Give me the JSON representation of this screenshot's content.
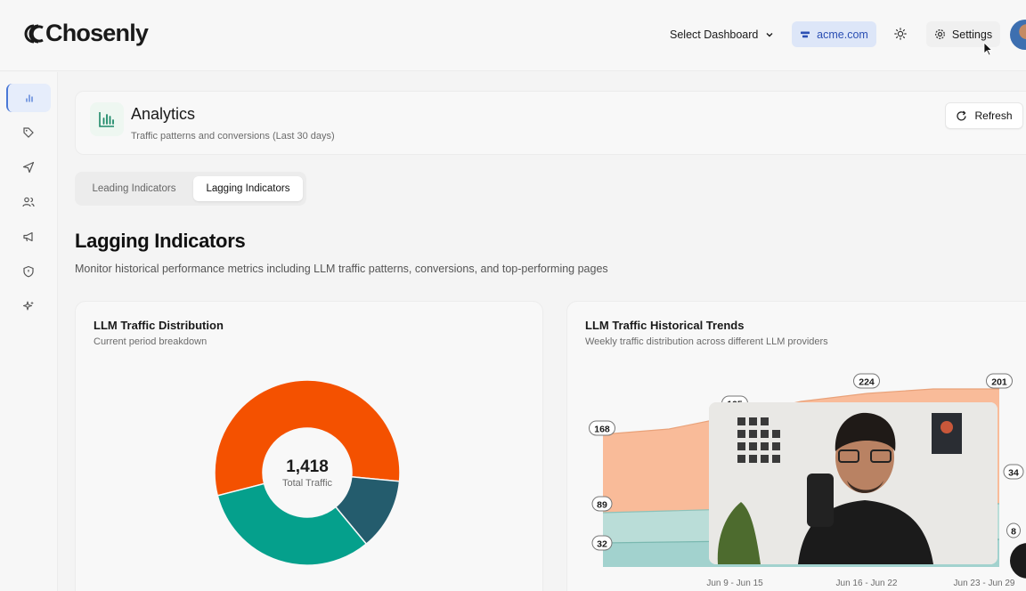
{
  "header": {
    "brand": "Chosenly",
    "select_dashboard": "Select Dashboard",
    "domain": "acme.com",
    "settings": "Settings"
  },
  "sidebar": {
    "items": [
      "analytics-icon",
      "tag-icon",
      "send-icon",
      "users-icon",
      "megaphone-icon",
      "shield-icon",
      "sparkles-icon"
    ],
    "active_index": 0
  },
  "page": {
    "title": "Analytics",
    "subtitle": "Traffic patterns and conversions (Last 30 days)",
    "refresh": "Refresh"
  },
  "tabs": [
    {
      "label": "Leading Indicators",
      "active": false
    },
    {
      "label": "Lagging Indicators",
      "active": true
    }
  ],
  "section": {
    "title": "Lagging Indicators",
    "description": "Monitor historical performance metrics including LLM traffic patterns, conversions, and top-performing pages"
  },
  "distribution_card": {
    "title": "LLM Traffic Distribution",
    "subtitle": "Current period breakdown",
    "total_value": "1,418",
    "total_label": "Total Traffic"
  },
  "trends_card": {
    "title": "LLM Traffic Historical Trends",
    "subtitle": "Weekly traffic distribution across different LLM providers"
  },
  "colors": {
    "orange": "#f45100",
    "teal": "#05a08c",
    "dark_teal": "#245c6d",
    "accent_blue": "#2b4fb3"
  },
  "chart_data": [
    {
      "type": "pie",
      "title": "LLM Traffic Distribution",
      "center_text": "1,418",
      "slices": [
        {
          "color": "#f45100",
          "fraction": 0.555
        },
        {
          "color": "#245c6d",
          "fraction": 0.125
        },
        {
          "color": "#05a08c",
          "fraction": 0.32
        }
      ]
    },
    {
      "type": "area",
      "title": "LLM Traffic Historical Trends",
      "categories": [
        "Jun 9 - Jun 15",
        "Jun 16 - Jun 22",
        "Jun 23 - Jun 29"
      ],
      "x_labels_visible": [
        "Jun 9 - Jun 15",
        "Jun 16 - Jun 22",
        "Jun 23 - Jun 29"
      ],
      "data_labels": {
        "left": [
          "168",
          "89",
          "32"
        ],
        "top": [
          "195",
          "224",
          "201"
        ],
        "right": [
          "34",
          "8"
        ]
      },
      "series": [
        {
          "color": "#f9b794"
        },
        {
          "color": "#b6dbd6"
        },
        {
          "color": "#9dd0cb"
        }
      ]
    }
  ]
}
